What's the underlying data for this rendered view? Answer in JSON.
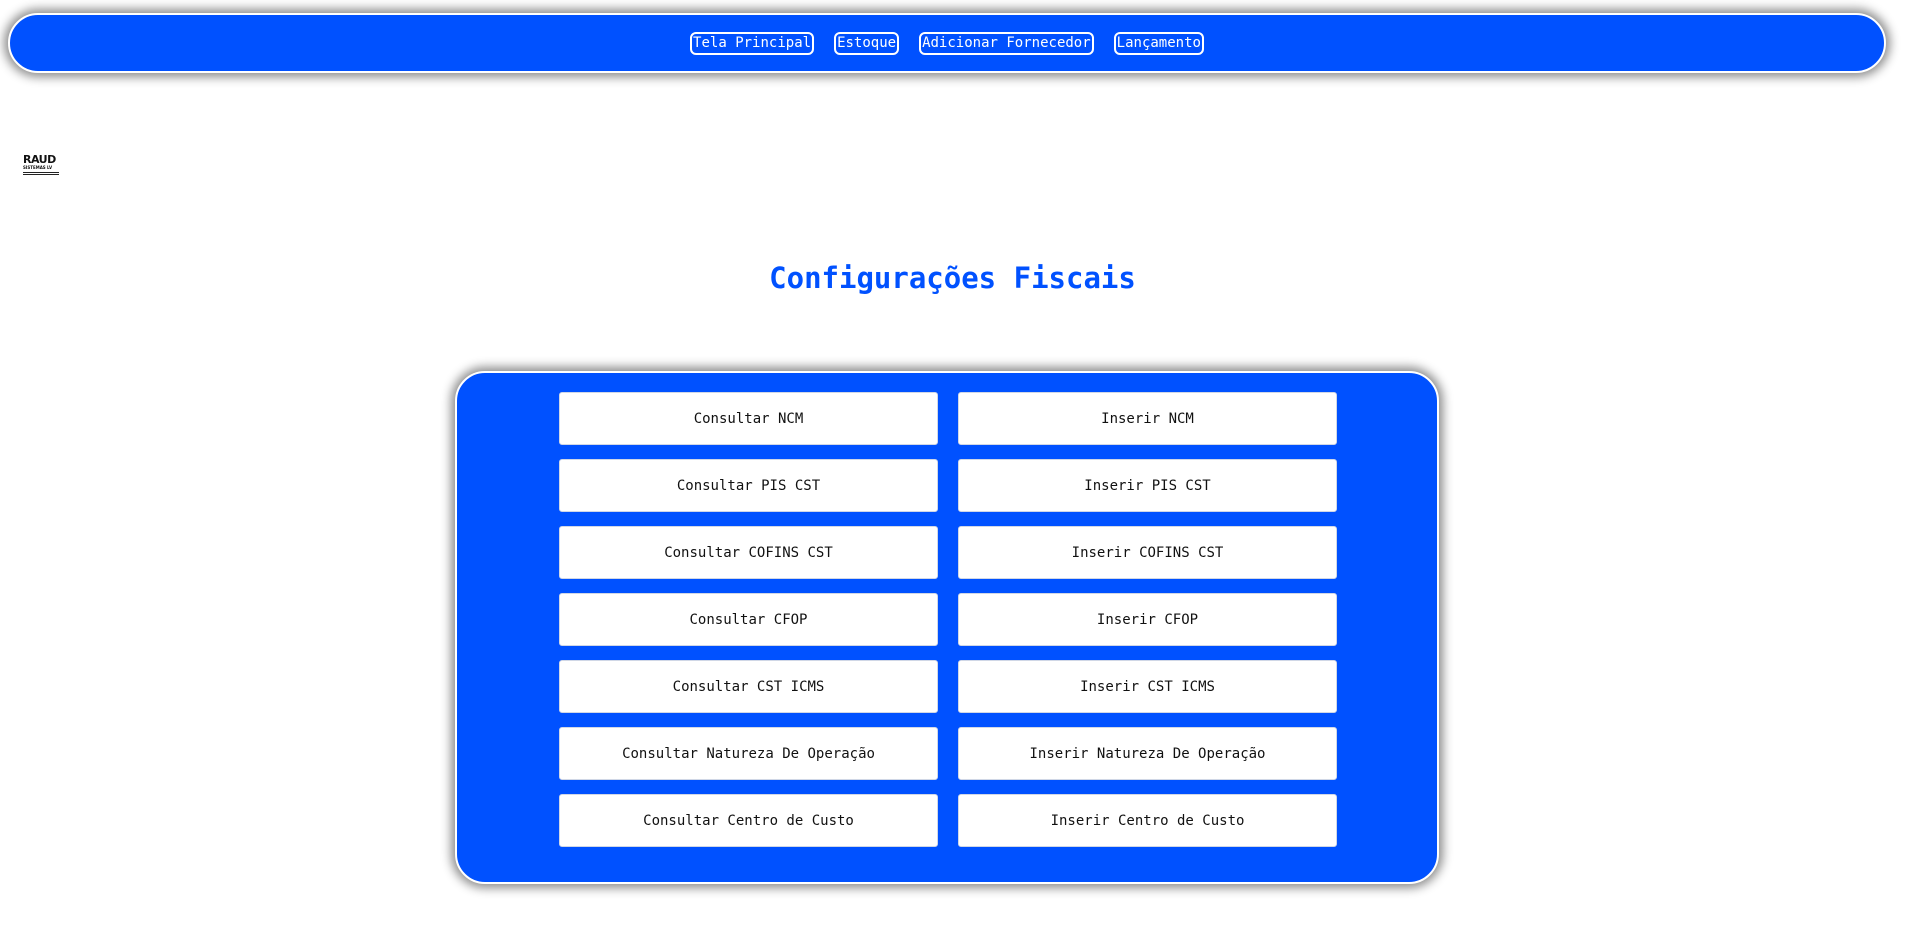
{
  "colors": {
    "accent": "#0051ff",
    "text": "#111111",
    "background": "#ffffff"
  },
  "nav": {
    "items": [
      {
        "label": "Tela Principal"
      },
      {
        "label": "Estoque"
      },
      {
        "label": "Adicionar Fornecedor"
      },
      {
        "label": "Lançamento"
      }
    ]
  },
  "logo": {
    "name": "RAUD",
    "tagline": "SISTEMAS LV"
  },
  "main": {
    "title": "Configurações Fiscais",
    "buttons": [
      {
        "label": "Consultar NCM"
      },
      {
        "label": "Inserir NCM"
      },
      {
        "label": "Consultar PIS CST"
      },
      {
        "label": "Inserir PIS CST"
      },
      {
        "label": "Consultar COFINS CST"
      },
      {
        "label": "Inserir COFINS CST"
      },
      {
        "label": "Consultar CFOP"
      },
      {
        "label": "Inserir CFOP"
      },
      {
        "label": "Consultar CST ICMS"
      },
      {
        "label": "Inserir CST ICMS"
      },
      {
        "label": "Consultar Natureza De Operação"
      },
      {
        "label": "Inserir Natureza De Operação"
      },
      {
        "label": "Consultar Centro de Custo"
      },
      {
        "label": "Inserir Centro de Custo"
      }
    ]
  }
}
